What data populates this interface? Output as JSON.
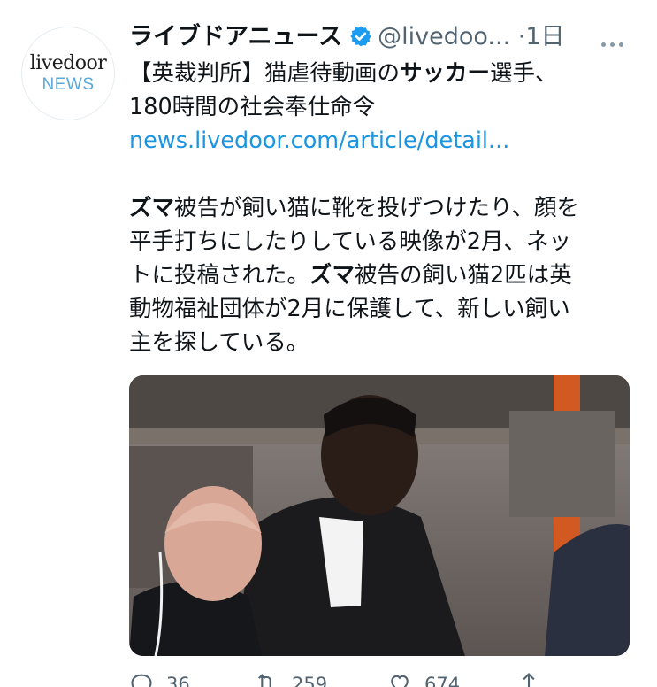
{
  "account": {
    "avatar": {
      "logo_line1": "livedoor",
      "logo_line2": "NEWS",
      "logo_color_top": "#1f1f1f",
      "logo_color_bottom": "#5aa7d8"
    },
    "display_name": "ライブドアニュース",
    "verified": true,
    "handle": "@livedoo...",
    "separator": "·",
    "time": "1日"
  },
  "tweet": {
    "line1_prefix": "【英裁判所】猫虐待動画の",
    "line1_bold": "サッカー",
    "line1_suffix": "選手、",
    "line2": "180時間の社会奉仕命令",
    "link": "news.livedoor.com/article/detail...",
    "p2_bold1": "ズマ",
    "p2_text1": "被告が飼い猫に靴を投げつけたり、顔を",
    "p2_text2": "平手打ちにしたりしている映像が2月、ネッ",
    "p2_text3": "トに投稿された。",
    "p2_bold2": "ズマ",
    "p2_text4": "被告の飼い猫2匹は英",
    "p2_text5": "動物福祉団体が2月に保護して、新しい飼い",
    "p2_text6": "主を探している。"
  },
  "actions": {
    "reply_count": "36",
    "retweet_count": "259",
    "like_count": "674"
  },
  "colors": {
    "link": "#1b95e0",
    "verified": "#1d9bf0",
    "secondary_text": "#536471"
  },
  "icons": [
    "verified-badge-icon",
    "more-icon",
    "reply-icon",
    "retweet-icon",
    "like-icon",
    "share-icon"
  ]
}
